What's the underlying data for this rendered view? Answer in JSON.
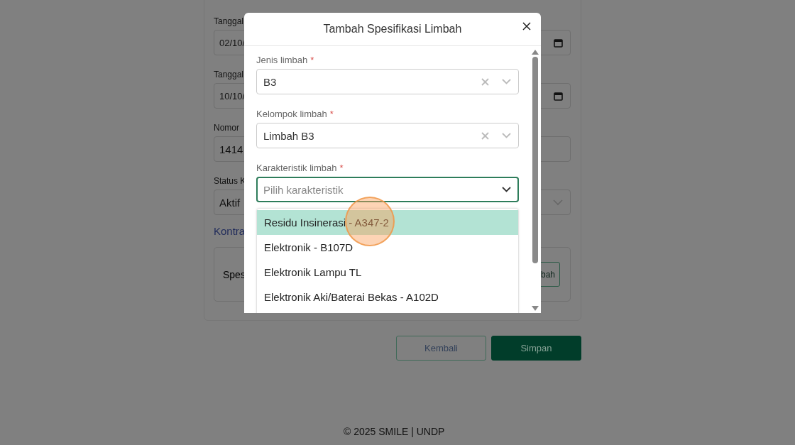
{
  "background_form": {
    "fields": [
      {
        "kind": "date",
        "label": "Tanggal",
        "value": "02/10/"
      },
      {
        "kind": "date",
        "label": "Tanggal",
        "value": "10/10/"
      },
      {
        "kind": "text",
        "label": "Nomor",
        "value": "1414"
      },
      {
        "kind": "select",
        "label": "Status K",
        "value": "Aktif"
      }
    ],
    "link": "Kontra",
    "section": {
      "title": "Spes",
      "button": "bah"
    }
  },
  "modal": {
    "title": "Tambah Spesifikasi Limbah",
    "required_mark": "*",
    "fields": [
      {
        "label": "Jenis limbah",
        "required": true,
        "value": "B3",
        "clearable": true,
        "focused": false
      },
      {
        "label": "Kelompok limbah",
        "required": true,
        "value": "Limbah B3",
        "clearable": true,
        "focused": false
      },
      {
        "label": "Karakteristik limbah",
        "required": true,
        "placeholder": "Pilih karakteristik",
        "clearable": false,
        "focused": true
      }
    ],
    "options": [
      {
        "label": "Residu Insinerasi - A347-2",
        "selected": true
      },
      {
        "label": "Elektronik - B107D",
        "selected": false
      },
      {
        "label": "Elektronik Lampu TL",
        "selected": false
      },
      {
        "label": "Elektronik Aki/Baterai Bekas - A102D",
        "selected": false
      }
    ]
  },
  "actions": [
    {
      "kind": "secondary",
      "label": "Kembali"
    },
    {
      "kind": "primary",
      "label": "Simpan"
    }
  ],
  "footer": "© 2025 SMILE | UNDP"
}
